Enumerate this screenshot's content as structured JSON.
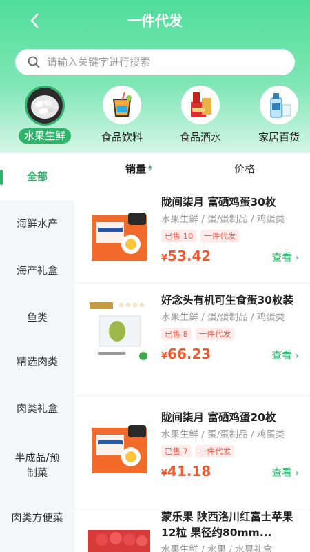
{
  "header": {
    "title": "一件代发",
    "back_icon": "chevron-left-icon"
  },
  "search": {
    "placeholder": "请输入关键字进行搜索"
  },
  "categories": [
    {
      "label": "水果生鲜",
      "icon": "seafood-icon",
      "active": true
    },
    {
      "label": "食品饮料",
      "icon": "drink-icon",
      "active": false
    },
    {
      "label": "食品酒水",
      "icon": "liquor-icon",
      "active": false
    },
    {
      "label": "家居百货",
      "icon": "household-icon",
      "active": false
    }
  ],
  "sidebar": {
    "items": [
      {
        "label": "全部",
        "active": true
      },
      {
        "label": "海鲜水产"
      },
      {
        "label": "海产礼盒"
      },
      {
        "label": "鱼类"
      },
      {
        "label": "精选肉类"
      },
      {
        "label": "肉类礼盒"
      },
      {
        "label": "半成品/预制菜"
      },
      {
        "label": "肉类方便菜"
      }
    ]
  },
  "sort": {
    "tab1": "销量",
    "tab2": "价格"
  },
  "products": [
    {
      "name": "陇间柒月 富硒鸡蛋30枚",
      "path": "水果生鲜 / 蛋/蛋制品 / 鸡蛋类",
      "sold": "已售 10",
      "tag": "一件代发",
      "currency": "¥",
      "price": "53.42",
      "view": "查看 ›"
    },
    {
      "name": "好念头有机可生食蛋30枚装",
      "path": "水果生鲜 / 蛋/蛋制品 / 鸡蛋类",
      "sold": "已售 8",
      "tag": "一件代发",
      "currency": "¥",
      "price": "66.23",
      "view": "查看 ›"
    },
    {
      "name": "陇间柒月 富硒鸡蛋20枚",
      "path": "水果生鲜 / 蛋/蛋制品 / 鸡蛋类",
      "sold": "已售 7",
      "tag": "一件代发",
      "currency": "¥",
      "price": "41.18",
      "view": "查看 ›"
    },
    {
      "name": "蒙乐果 陕西洛川红富士苹果12粒 果径约80mm...",
      "path": "水果生鲜 / 水果 / 水果礼盒"
    }
  ],
  "colors": {
    "accent": "#2fb46c",
    "price": "#f05a2e",
    "tag": "#f05a4a"
  }
}
